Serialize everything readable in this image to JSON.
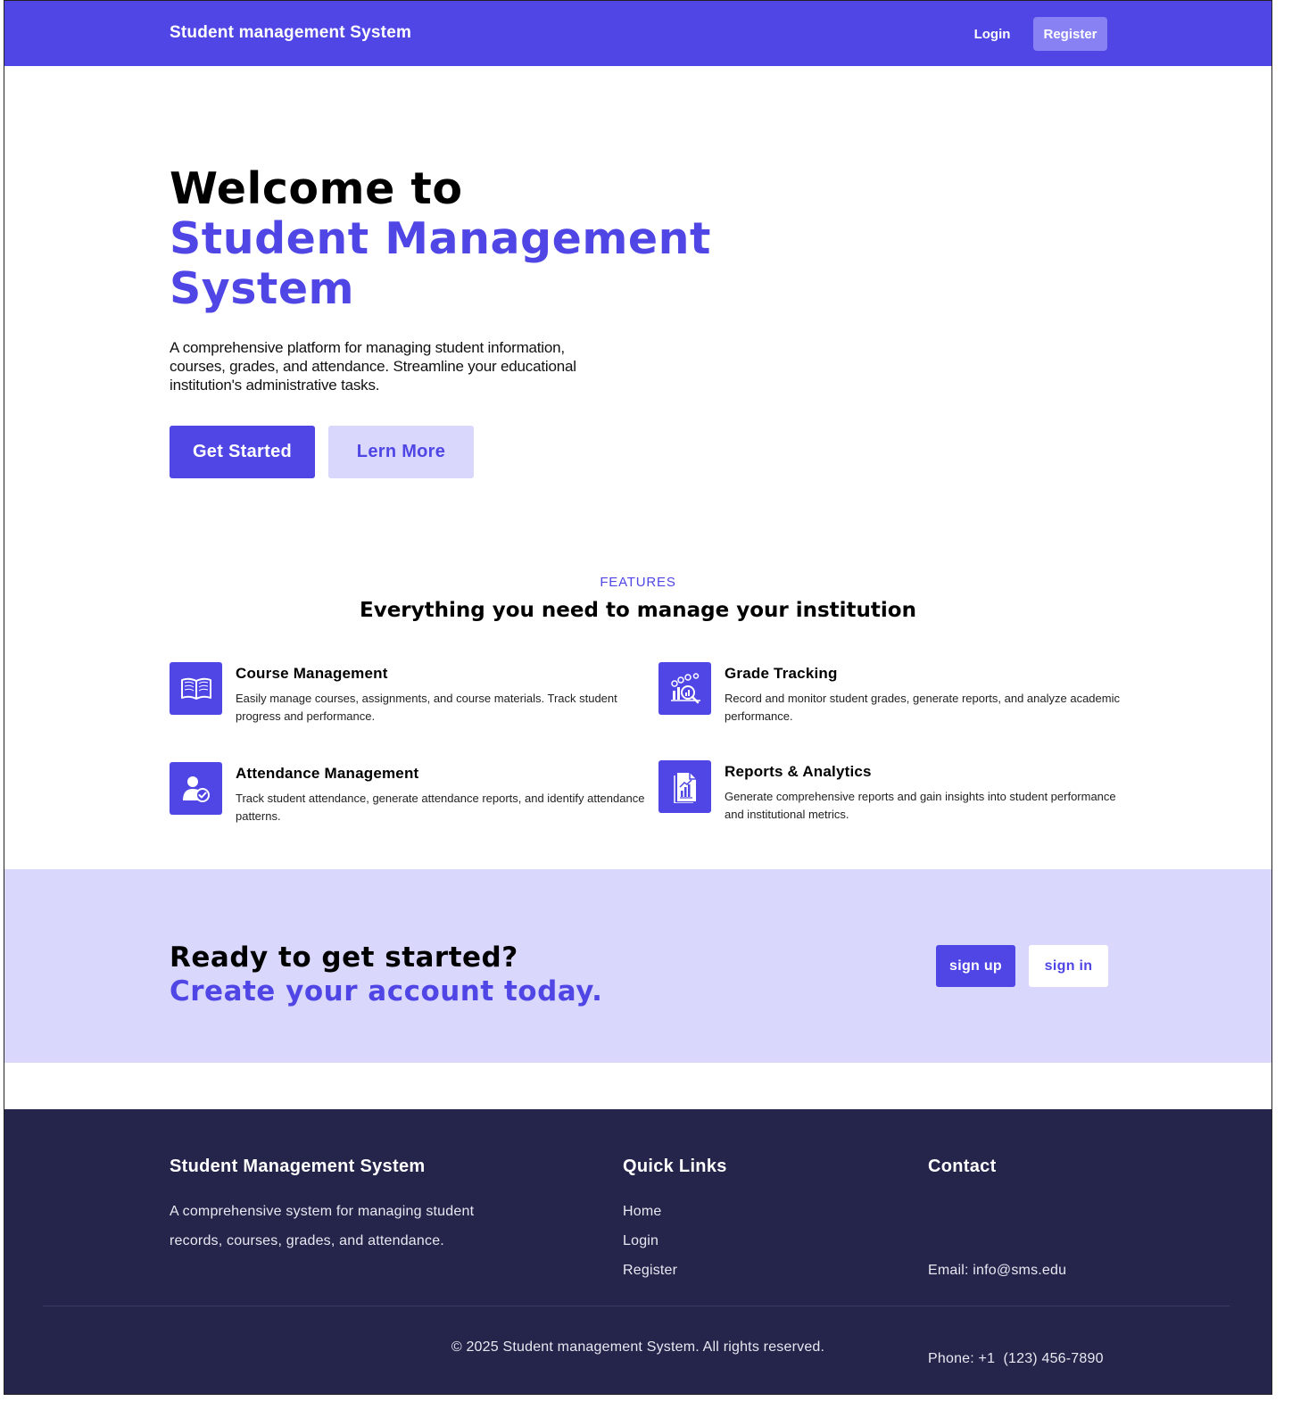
{
  "navbar": {
    "brand": "Student management System",
    "login_label": "Login",
    "register_label": "Register"
  },
  "hero": {
    "title_line1": "Welcome to",
    "title_line2": "Student Management",
    "title_line3": "System",
    "description": "A comprehensive platform for managing student information, courses, grades, and attendance. Streamline your educational institution's administrative tasks.",
    "primary_button": "Get Started",
    "secondary_button": "Lern More"
  },
  "features": {
    "eyebrow": "FEATURES",
    "heading": "Everything you need to manage your institution",
    "items": [
      {
        "icon": "book-icon",
        "title": "Course Management",
        "description": "Easily manage courses, assignments, and course materials. Track student progress and performance."
      },
      {
        "icon": "analytics-search-icon",
        "title": "Grade Tracking",
        "description": "Record and monitor student grades, generate reports, and analyze academic performance."
      },
      {
        "icon": "user-check-icon",
        "title": "Attendance Management",
        "description": "Track student attendance, generate attendance reports, and identify attendance patterns."
      },
      {
        "icon": "report-chart-icon",
        "title": "Reports & Analytics",
        "description": "Generate comprehensive reports and gain insights into student performance and institutional metrics."
      }
    ]
  },
  "cta": {
    "title_line1": "Ready to get started?",
    "title_line2": "Create your account today.",
    "signup_label": "sign up",
    "signin_label": "sign in"
  },
  "footer": {
    "about_title": "Student Management System",
    "about_text": "A comprehensive system for managing student records, courses, grades, and attendance.",
    "links_title": "Quick Links",
    "links": [
      "Home",
      "Login",
      "Register"
    ],
    "contact_title": "Contact",
    "email": "Email: info@sms.edu",
    "phone": "Phone: +1  (123) 456-7890",
    "copyright": "© 2025 Student management System. All rights reserved."
  },
  "colors": {
    "primary": "#4f46e5",
    "primary_light": "#d9d7fc",
    "register_button": "#8781f4",
    "footer_bg": "#25244a"
  }
}
